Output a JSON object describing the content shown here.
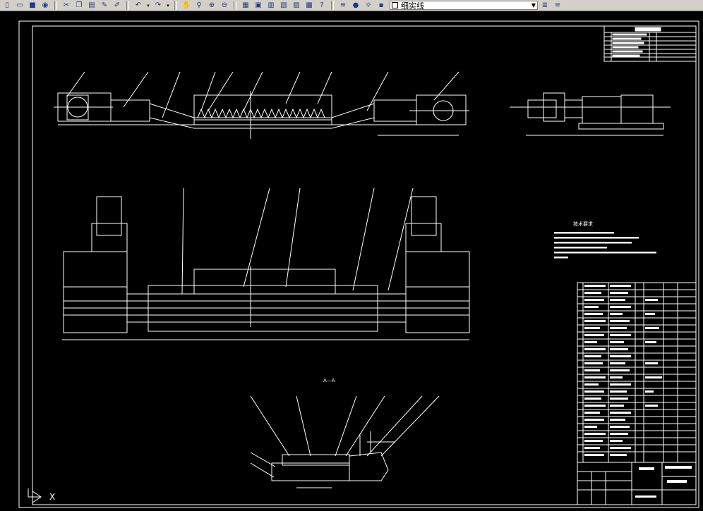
{
  "toolbar": {
    "buttons": [
      {
        "name": "new-file-icon",
        "glyph": "▯"
      },
      {
        "name": "open-file-icon",
        "glyph": "▭"
      },
      {
        "name": "save-icon",
        "glyph": "■"
      },
      {
        "name": "plot-icon",
        "glyph": "◉"
      },
      {
        "name": "cut-icon",
        "glyph": "✂"
      },
      {
        "name": "copy-icon",
        "glyph": "❐"
      },
      {
        "name": "paste-icon",
        "glyph": "▤"
      },
      {
        "name": "match-properties-icon",
        "glyph": "✎"
      },
      {
        "name": "block-editor-icon",
        "glyph": "✐"
      },
      {
        "name": "undo-icon",
        "glyph": "↶"
      },
      {
        "name": "redo-icon",
        "glyph": "↷"
      },
      {
        "name": "pan-icon",
        "glyph": "✋"
      },
      {
        "name": "zoom-realtime-icon",
        "glyph": "⚲"
      },
      {
        "name": "zoom-window-icon",
        "glyph": "⊕"
      },
      {
        "name": "zoom-previous-icon",
        "glyph": "⊖"
      },
      {
        "name": "properties-icon",
        "glyph": "▦"
      },
      {
        "name": "design-center-icon",
        "glyph": "▣"
      },
      {
        "name": "tool-palettes-icon",
        "glyph": "▥"
      },
      {
        "name": "sheet-set-icon",
        "glyph": "▧"
      },
      {
        "name": "markup-icon",
        "glyph": "▨"
      },
      {
        "name": "calculator-icon",
        "glyph": "▩"
      },
      {
        "name": "help-icon",
        "glyph": "?"
      },
      {
        "name": "layer-manager-icon",
        "glyph": "≋"
      },
      {
        "name": "layer-on-icon",
        "glyph": "●"
      },
      {
        "name": "layer-freeze-icon",
        "glyph": "☼"
      },
      {
        "name": "layer-lock-icon",
        "glyph": "▪"
      }
    ],
    "linetype_value": "细实线",
    "right_icons": [
      {
        "name": "layer-previous-icon",
        "glyph": "≣"
      },
      {
        "name": "layer-states-icon",
        "glyph": "≡"
      }
    ]
  },
  "drawing": {
    "section_label": "A—A",
    "tech_requirements_title": "技术要求",
    "ucs_x_label": "X"
  }
}
